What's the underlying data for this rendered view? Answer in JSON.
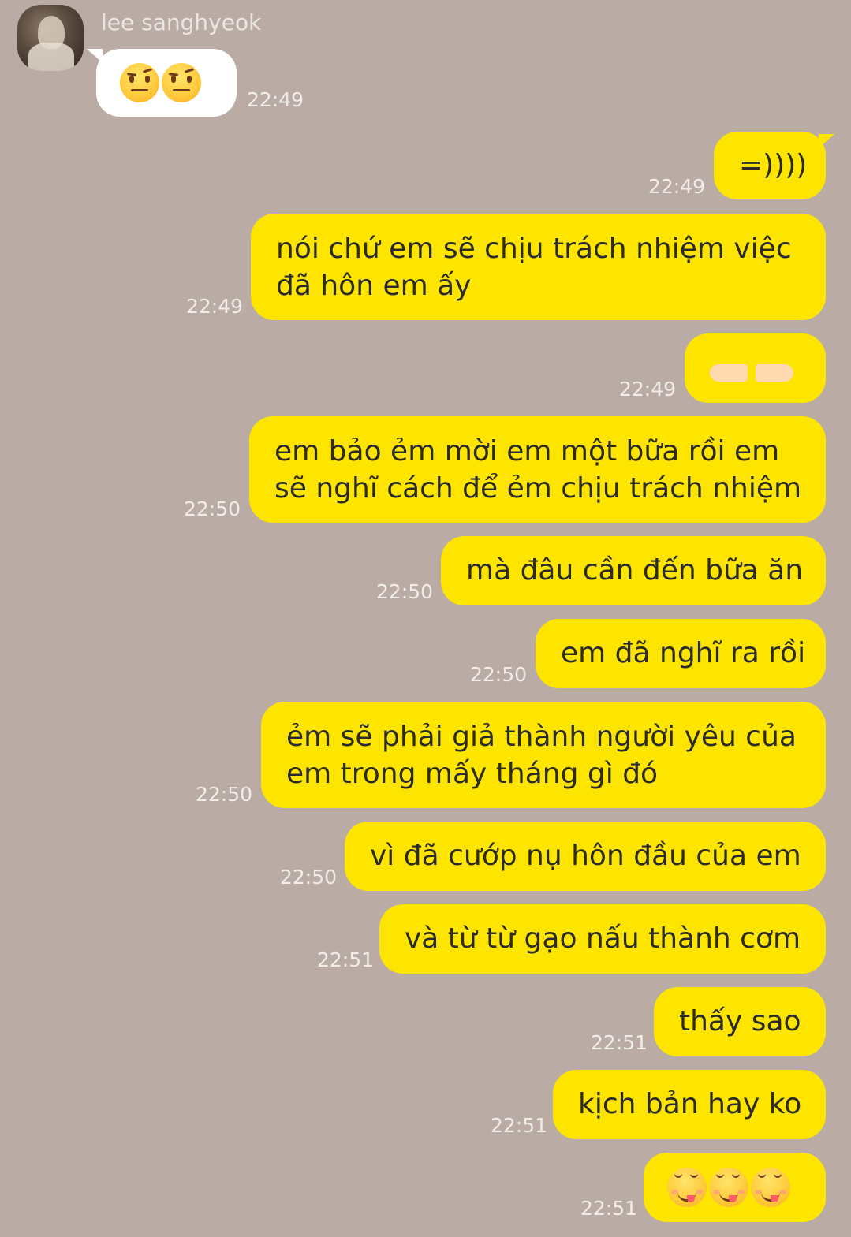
{
  "chat": {
    "contact_name": "lee sanghyeok",
    "messages": [
      {
        "from": "them",
        "text": "",
        "emoji": [
          "face-with-raised-eyebrow",
          "face-with-raised-eyebrow"
        ],
        "time": "22:49"
      },
      {
        "from": "me",
        "text": "=))))",
        "time": "22:49"
      },
      {
        "from": "me",
        "text": "nói chứ em sẽ chịu trách nhiệm việc đã hôn em ấy",
        "lines": [
          "nói chứ em sẽ chịu trách nhiệm việc",
          "đã hôn em ấy"
        ],
        "time": "22:49"
      },
      {
        "from": "me",
        "text": "",
        "emoji": [
          "fingers-pointing-together"
        ],
        "time": "22:49"
      },
      {
        "from": "me",
        "text": "em bảo ẻm mời em một bữa rồi em sẽ nghĩ cách để ẻm chịu trách nhiệm",
        "lines": [
          "em bảo ẻm mời em một bữa rồi em",
          "sẽ nghĩ cách để ẻm chịu trách nhiệm"
        ],
        "time": "22:50"
      },
      {
        "from": "me",
        "text": "mà đâu cần đến bữa ăn",
        "time": "22:50"
      },
      {
        "from": "me",
        "text": "em đã nghĩ ra rồi",
        "time": "22:50"
      },
      {
        "from": "me",
        "text": "ẻm sẽ phải giả thành người yêu của em trong mấy tháng gì đó",
        "lines": [
          "ẻm sẽ phải giả thành người yêu của",
          "em trong mấy tháng gì đó"
        ],
        "time": "22:50"
      },
      {
        "from": "me",
        "text": "vì đã cướp nụ hôn đầu của em",
        "time": "22:50"
      },
      {
        "from": "me",
        "text": "và từ từ gạo nấu thành cơm",
        "time": "22:51"
      },
      {
        "from": "me",
        "text": "thấy sao",
        "time": "22:51"
      },
      {
        "from": "me",
        "text": "kịch bản hay ko",
        "time": "22:51"
      },
      {
        "from": "me",
        "text": "",
        "emoji": [
          "face-savoring-food",
          "face-savoring-food",
          "face-savoring-food"
        ],
        "time": "22:51"
      }
    ]
  },
  "colors": {
    "background": "#baaca5",
    "incoming_bubble": "#ffffff",
    "outgoing_bubble": "#fee500",
    "timestamp": "#f1ecea"
  }
}
